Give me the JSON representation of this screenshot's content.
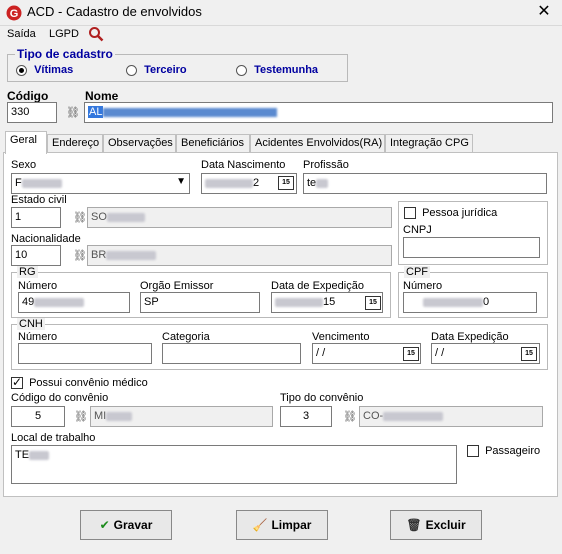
{
  "window": {
    "title": "ACD - Cadastro de envolvidos",
    "close_glyph": "✕",
    "app_icon": "app-logo-icon"
  },
  "menu": {
    "items": [
      "Saída",
      "LGPD"
    ],
    "search_icon": "magnifier-icon"
  },
  "tipo_cadastro": {
    "legend": "Tipo de cadastro",
    "options": [
      "Vítimas",
      "Terceiro",
      "Testemunha"
    ],
    "selected": "Vítimas"
  },
  "codigo": {
    "label": "Código",
    "value": "330"
  },
  "nome": {
    "label": "Nome",
    "value": "AL"
  },
  "tabs": [
    "Geral",
    "Endereço",
    "Observações",
    "Beneficiários",
    "Acidentes Envolvidos(RA)",
    "Integração CPG"
  ],
  "geral": {
    "sexo": {
      "label": "Sexo",
      "value": "F"
    },
    "data_nascimento": {
      "label": "Data Nascimento",
      "value": "2"
    },
    "profissao": {
      "label": "Profissão",
      "value": "te"
    },
    "estado_civil": {
      "label": "Estado civil",
      "code": "1",
      "desc": "SO"
    },
    "pessoa_juridica": {
      "label": "Pessoa jurídica",
      "checked": false
    },
    "cnpj": {
      "label": "CNPJ",
      "value": ""
    },
    "nacionalidade": {
      "label": "Nacionalidade",
      "code": "10",
      "desc": "BR"
    },
    "rg": {
      "legend": "RG",
      "numero_label": "Número",
      "numero": "49",
      "orgao_label": "Orgão Emissor",
      "orgao": "SP",
      "expedicao_label": "Data de Expedição",
      "expedicao": "15"
    },
    "cpf": {
      "legend": "CPF",
      "numero_label": "Número",
      "numero": "0"
    },
    "cnh": {
      "legend": "CNH",
      "numero_label": "Número",
      "numero": "",
      "categoria_label": "Categoria",
      "categoria": "",
      "vencimento_label": "Vencimento",
      "vencimento": " / /",
      "expedicao_label": "Data Expedição",
      "expedicao": " / /"
    },
    "convenio": {
      "possui_label": "Possui convênio médico",
      "possui": true,
      "codigo_label": "Código do convênio",
      "codigo": "5",
      "codigo_desc": "MI",
      "tipo_label": "Tipo do convênio",
      "tipo": "3",
      "tipo_desc": "CO-"
    },
    "local_trabalho": {
      "label": "Local de trabalho",
      "value": "TE"
    },
    "passageiro": {
      "label": "Passageiro",
      "checked": false
    },
    "calendar_badge": "15"
  },
  "buttons": {
    "gravar": "Gravar",
    "limpar": "Limpar",
    "excluir": "Excluir"
  },
  "colors": {
    "accent_blue": "#0000a0",
    "selection": "#3377dd",
    "app_icon_red": "#cc2222"
  }
}
